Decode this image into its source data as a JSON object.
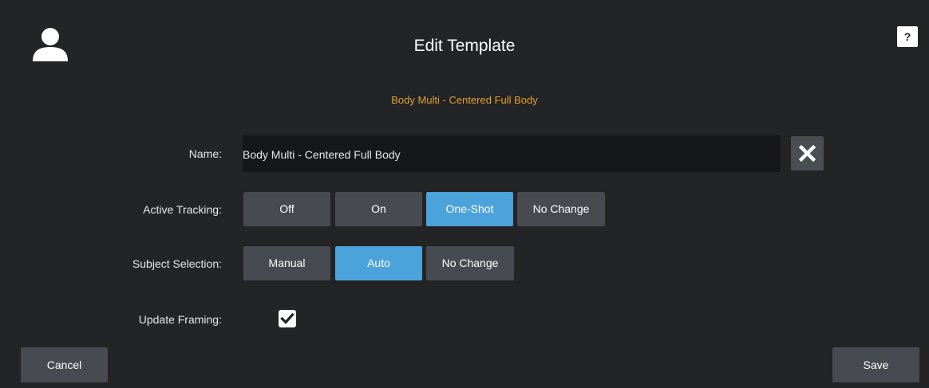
{
  "header": {
    "avatar_icon": "user-icon",
    "title": "Edit Template",
    "help_label": "?"
  },
  "template": {
    "subtitle": "Body Multi - Centered Full Body"
  },
  "form": {
    "name": {
      "label": "Name:",
      "value": "Body Multi - Centered Full Body",
      "clear_icon": "close-icon"
    },
    "active_tracking": {
      "label": "Active Tracking:",
      "options": [
        "Off",
        "On",
        "One-Shot",
        "No Change"
      ],
      "selected": "One-Shot"
    },
    "subject_selection": {
      "label": "Subject Selection:",
      "options": [
        "Manual",
        "Auto",
        "No Change"
      ],
      "selected": "Auto"
    },
    "update_framing": {
      "label": "Update Framing:",
      "checked": true
    }
  },
  "footer": {
    "cancel_label": "Cancel",
    "save_label": "Save"
  },
  "colors": {
    "background": "#232425",
    "button": "#474a50",
    "active": "#4ca3dc",
    "accent_text": "#e0a030",
    "input_bg": "#161718"
  }
}
